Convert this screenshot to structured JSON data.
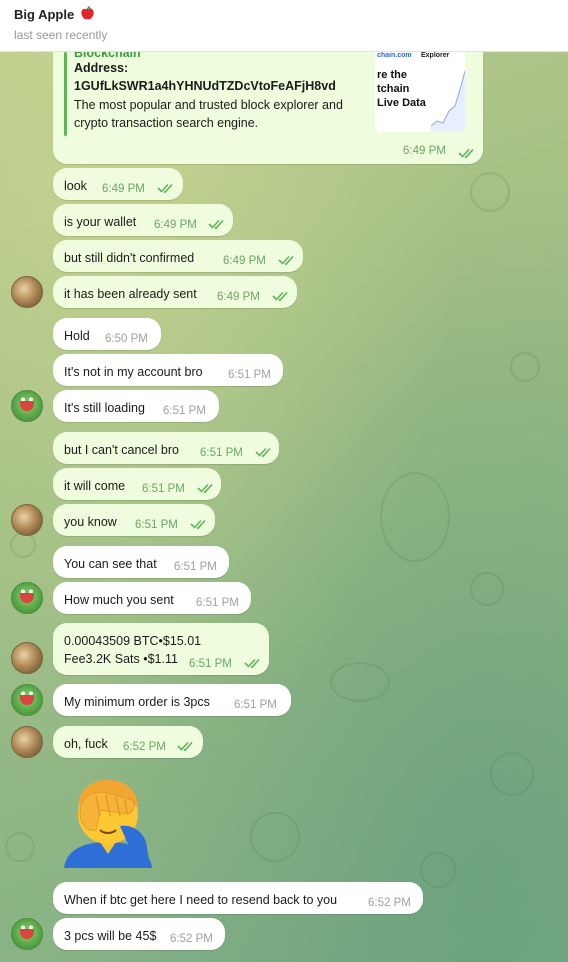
{
  "chat": {
    "title": "Big Apple",
    "title_emoji_icon": "red-apple-icon",
    "status": "last seen recently"
  },
  "link_preview": {
    "site_name": "Blockchain",
    "address_label": "Address:",
    "address": "1GUfLkSWR1a4hYHNUdTZDcVtoFeAFjH8vd",
    "description_line1": "The most popular and trusted block explorer and",
    "description_line2": "crypto transaction search engine.",
    "thumb_brand": "chain.com",
    "thumb_brand2": "Explorer",
    "thumb_line1": "re the",
    "thumb_line2": "tchain",
    "thumb_line3": "Live Data",
    "time": "6:49 PM"
  },
  "messages": [
    {
      "id": "m1",
      "text": "look",
      "time": "6:49 PM",
      "out": true
    },
    {
      "id": "m2",
      "text": "is your wallet",
      "time": "6:49 PM",
      "out": true
    },
    {
      "id": "m3",
      "text": "but still didn't confirmed",
      "time": "6:49 PM",
      "out": true
    },
    {
      "id": "m4",
      "text": "it has been already sent",
      "time": "6:49 PM",
      "out": true
    },
    {
      "id": "m5",
      "text": "Hold",
      "time": "6:50 PM",
      "out": false
    },
    {
      "id": "m6",
      "text": "It's not in my account bro",
      "time": "6:51 PM",
      "out": false
    },
    {
      "id": "m7",
      "text": "It's still loading",
      "time": "6:51 PM",
      "out": false
    },
    {
      "id": "m8",
      "text": "but I can't cancel bro",
      "time": "6:51 PM",
      "out": true
    },
    {
      "id": "m9",
      "text": "it will come",
      "time": "6:51 PM",
      "out": true
    },
    {
      "id": "m10",
      "text": "you know",
      "time": "6:51 PM",
      "out": true
    },
    {
      "id": "m11",
      "text": "You can see that",
      "time": "6:51 PM",
      "out": false
    },
    {
      "id": "m12",
      "text": "How much you sent",
      "time": "6:51 PM",
      "out": false
    },
    {
      "id": "m13",
      "text": "0.00043509 BTC•$15.01",
      "text2": "Fee3.2K Sats •$1.11",
      "time": "6:51 PM",
      "out": true
    },
    {
      "id": "m14",
      "text": "My minimum order is 3pcs",
      "time": "6:51 PM",
      "out": false
    },
    {
      "id": "m15",
      "text": "oh, fuck",
      "time": "6:52 PM",
      "out": true
    },
    {
      "id": "m16",
      "text": "When if btc get here I need to resend back to you",
      "time": "6:52 PM",
      "out": false
    },
    {
      "id": "m17",
      "text": "3 pcs will be 45$",
      "time": "6:52 PM",
      "out": false
    }
  ],
  "sticker": {
    "icon": "facepalm-emoji-icon"
  },
  "colors": {
    "outgoing_bubble": "#effdde",
    "incoming_bubble": "#ffffff",
    "outgoing_time": "#6aa667",
    "link_accent": "#5fb558"
  }
}
